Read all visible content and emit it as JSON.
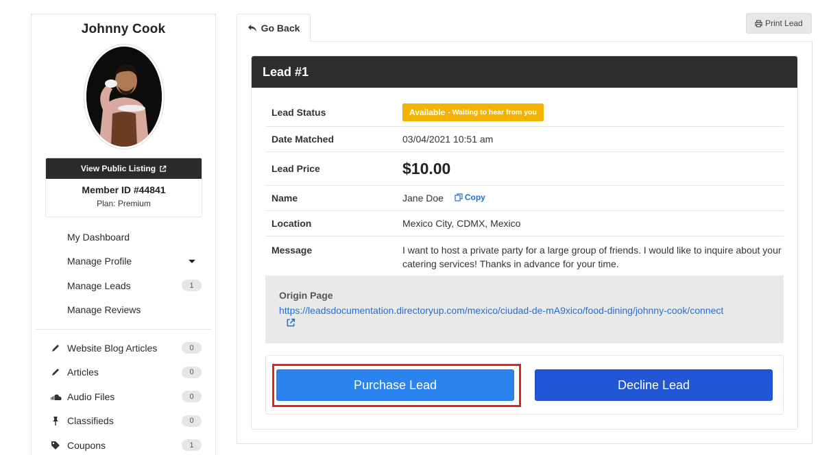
{
  "sidebar": {
    "member_name": "Johnny Cook",
    "public_listing_label": "View Public Listing",
    "member_id": "Member ID #44841",
    "plan": "Plan: Premium",
    "menu": [
      {
        "label": "My Dashboard"
      },
      {
        "label": "Manage Profile",
        "dropdown": true
      },
      {
        "label": "Manage Leads",
        "badge": "1"
      },
      {
        "label": "Manage Reviews"
      }
    ],
    "features": [
      {
        "label": "Website Blog Articles",
        "icon": "pencil-icon",
        "badge": "0"
      },
      {
        "label": "Articles",
        "icon": "pencil-icon",
        "badge": "0"
      },
      {
        "label": "Audio Files",
        "icon": "soundcloud-icon",
        "badge": "0"
      },
      {
        "label": "Classifieds",
        "icon": "pin-icon",
        "badge": "0"
      },
      {
        "label": "Coupons",
        "icon": "tag-icon",
        "badge": "1"
      }
    ]
  },
  "toolbar": {
    "go_back_label": "Go Back",
    "print_label": "Print Lead"
  },
  "lead": {
    "title": "Lead #1",
    "status_label": "Lead Status",
    "status_value": "Available",
    "status_sub": "- Waiting to hear from you",
    "date_label": "Date Matched",
    "date_value": "03/04/2021 10:51 am",
    "price_label": "Lead Price",
    "price_value": "$10.00",
    "name_label": "Name",
    "name_value": "Jane Doe",
    "copy_label": "Copy",
    "location_label": "Location",
    "location_value": "Mexico City, CDMX, Mexico",
    "message_label": "Message",
    "message_value": "I want to host a private party for a large group of friends. I would like to inquire about your catering services! Thanks in advance for your time.",
    "origin_title": "Origin Page",
    "origin_url": "https://leadsdocumentation.directoryup.com/mexico/ciudad-de-mA9xico/food-dining/johnny-cook/connect"
  },
  "actions": {
    "purchase_label": "Purchase Lead",
    "decline_label": "Decline Lead"
  },
  "colors": {
    "status_badge": "#f5b301",
    "purchase_button": "#2a83ee",
    "decline_button": "#2356d6",
    "highlight_border": "#e4231a",
    "header_bg": "#2d2d2d",
    "link": "#1f6fd6"
  }
}
